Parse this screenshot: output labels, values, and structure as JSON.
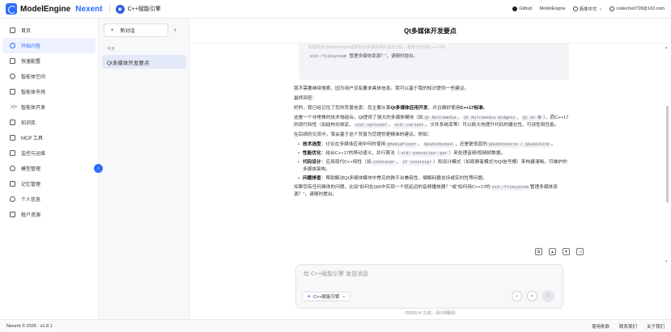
{
  "topbar": {
    "brand": "ModelEngine",
    "brand_accent": "Nexent",
    "app_title": "C++赋能引擎",
    "github": "Github",
    "modelengine": "ModelEngine",
    "language": "简体中文",
    "user": "codecho0728@163.com"
  },
  "sidebar": {
    "items": [
      {
        "label": "首页",
        "icon": "home-icon"
      },
      {
        "label": "开始问答",
        "icon": "chat-icon"
      },
      {
        "label": "快速配置",
        "icon": "bolt-icon"
      },
      {
        "label": "智能体空间",
        "icon": "globe-icon"
      },
      {
        "label": "智能体市场",
        "icon": "store-icon"
      },
      {
        "label": "智能体开发",
        "icon": "code-icon"
      },
      {
        "label": "知识库",
        "icon": "book-icon"
      },
      {
        "label": "MCP 工具",
        "icon": "plug-icon"
      },
      {
        "label": "监控与运维",
        "icon": "monitor-icon"
      },
      {
        "label": "模型管理",
        "icon": "cube-icon"
      },
      {
        "label": "记忆管理",
        "icon": "memory-icon"
      },
      {
        "label": "个人信息",
        "icon": "user-icon"
      },
      {
        "label": "租户资源",
        "icon": "tenant-icon"
      }
    ],
    "active_index": 1
  },
  "conversations": {
    "new_chat": "新对话",
    "group": "今天",
    "items": [
      "Qt多媒体开发要点"
    ]
  },
  "chat": {
    "title": "Qt多媒体开发要点",
    "quote_faded": "如需使用QMediaPlayer或其他Qt多媒体类的具体代码，或者\"如何用C++17的",
    "quote_code": "std::filesystem",
    "quote_tail": "管理多媒体资源？\"，请随时提出。",
    "p1": "我不需要继续搜索，因为用户没有要求具体信息。我可以基于我的知识提供一些建议。",
    "p2": "最终回答：",
    "p3a": "好的，我已经记住了您的背景信息：您主要从事",
    "p3b": "Qt多媒体应用开发",
    "p3c": "，并且偏好使用",
    "p3d": "C++17标准",
    "p3e": "。",
    "p4a": "这是一个非常棒的技术栈组合。Qt提供了强大的多媒体模块（如",
    "p4c1": "Qt Multimedia",
    "p4s1": "、",
    "p4c2": "Qt Multimedia Widgets",
    "p4s2": "、",
    "p4c3": "Qt AV 等",
    "p4b": "），而C++17的现代特性（如结构化绑定、",
    "p4c4": "std::optional",
    "p4s3": "、",
    "p4c5": "std::variant",
    "p4d": "、文件系统库等）可以极大地提升代码的健壮性、可读性和性能。",
    "p5": "在后续的交流中，我会基于这个背景为您提供更精准的建议。例如：",
    "b1_title": "技术选型",
    "b1a": "：讨论在多媒体应用中何时使用",
    "b1c1": "QMediaPlayer",
    "b1s": "、",
    "b1c2": "QAudioOutput",
    "b1b": "，还是更低层的",
    "b1c3": "QAudioSource / QAudioSink",
    "b1e": "。",
    "b2_title": "性能优化",
    "b2a": "：结合C++17的移动语义、并行算法（",
    "b2c": "std::execution::par",
    "b2b": "）来处理音频/视频帧数据。",
    "b3_title": "代码设计",
    "b3a": "：应用现代C++特性（如",
    "b3c1": "constexpr",
    "b3s": "、",
    "b3c2": "if constexpr",
    "b3b": "）和设计模式（如观察者模式与Qt信号槽）来构建清晰、可维护的多媒体架构。",
    "b4_title": "问题排查",
    "b4a": "：帮助解决Qt多媒体模块中常见的跨平台兼容性、编解码器支持或实时性等问题。",
    "p6a": "如果您有任何具体的问题，比如\"如何在Qt6中实现一个低延迟的音频播放器？\"或\"如何用C++17的",
    "p6c": "std::filesystem",
    "p6b": "管理多媒体资源？\"，请随时提出。"
  },
  "composer": {
    "placeholder": "给 C++赋能引擎 发送消息",
    "model_chip": "C++赋能引擎",
    "disclaimer": "内容由 AI 生成，请仔细甄别"
  },
  "footer": {
    "copyright": "Nexent © 2026 · v1.8.1",
    "links": [
      "使用条款",
      "联系我们",
      "关于我们"
    ]
  }
}
